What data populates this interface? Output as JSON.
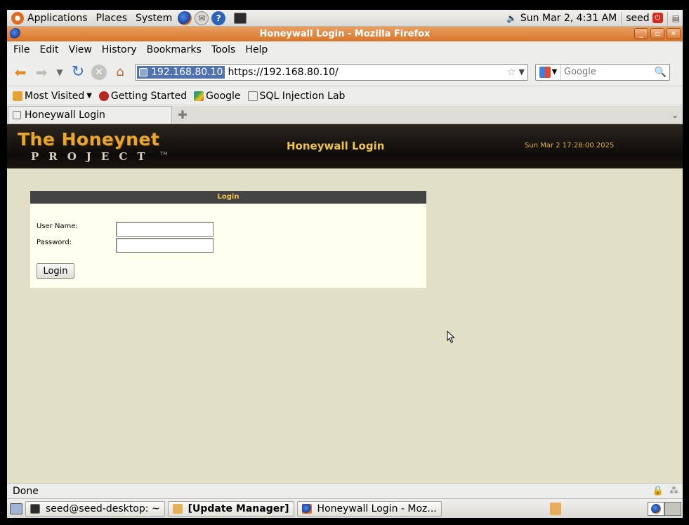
{
  "top_panel": {
    "menus": [
      "Applications",
      "Places",
      "System"
    ],
    "clock": "Sun Mar  2,  4:31 AM",
    "user": "seed"
  },
  "window": {
    "title": "Honeywall Login - Mozilla Firefox"
  },
  "menubar": {
    "items": [
      "File",
      "Edit",
      "View",
      "History",
      "Bookmarks",
      "Tools",
      "Help"
    ]
  },
  "navbar": {
    "site_identity": "192.168.80.10",
    "url": "https://192.168.80.10/",
    "search_placeholder": "Google"
  },
  "bookmarks": {
    "items": [
      "Most Visited",
      "Getting Started",
      "Google",
      "SQL Injection Lab"
    ]
  },
  "tabs": {
    "active_label": "Honeywall Login"
  },
  "page": {
    "logo_title": "The Honeynet",
    "logo_project": "PROJECT",
    "logo_tm": "TM",
    "header_title": "Honeywall Login",
    "header_date": "Sun Mar 2 17:28:00 2025",
    "login": {
      "box_title": "Login",
      "username_label": "User Name:",
      "password_label": "Password:",
      "username_value": "",
      "password_value": "",
      "button_label": "Login"
    }
  },
  "statusbar": {
    "text": "Done"
  },
  "taskbar": {
    "tasks": [
      "seed@seed-desktop: ~",
      "[Update Manager]",
      "Honeywall Login - Moz..."
    ]
  },
  "colors": {
    "page_bg": "#e1dfc6",
    "accent_gold": "#f0c34a",
    "titlebar_orange": "#d7762c"
  }
}
